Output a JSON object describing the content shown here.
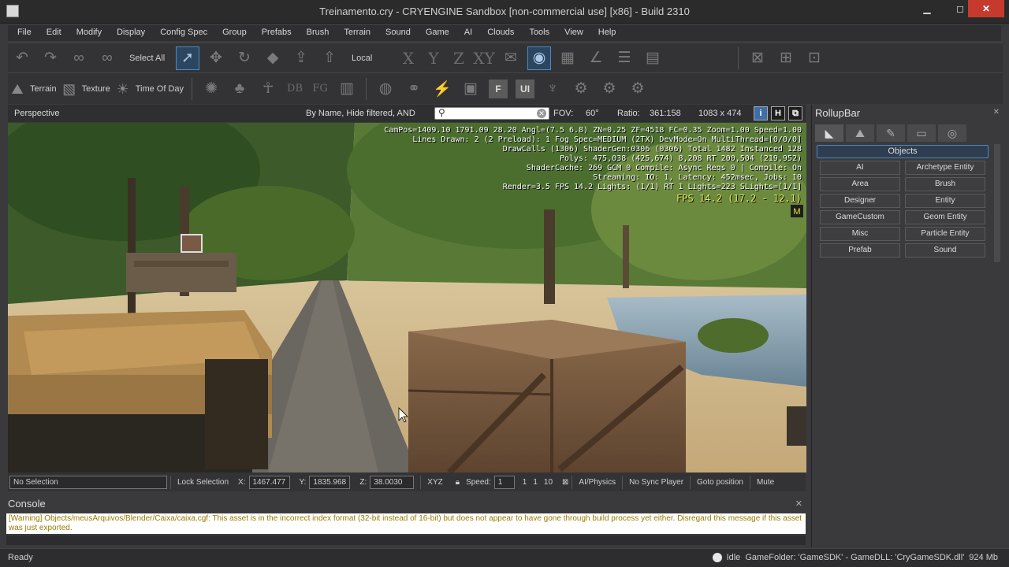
{
  "window": {
    "title": "Treinamento.cry - CRYENGINE Sandbox [non-commercial use] [x86] - Build 2310",
    "minimize": "▁",
    "maximize": "◻",
    "close": "✕"
  },
  "menu": [
    "File",
    "Edit",
    "Modify",
    "Display",
    "Config Spec",
    "Group",
    "Prefabs",
    "Brush",
    "Terrain",
    "Sound",
    "Game",
    "AI",
    "Clouds",
    "Tools",
    "View",
    "Help"
  ],
  "toolbar1": {
    "select_all": "Select All",
    "coord_space": "Local",
    "axis_x": "X",
    "axis_y": "Y",
    "axis_z": "Z",
    "axis_xy": "XY"
  },
  "toolbar2": {
    "terrain": "Terrain",
    "texture": "Texture",
    "time_of_day": "Time Of Day",
    "db": "DB",
    "fg": "FG",
    "f": "F",
    "ui": "UI"
  },
  "viewport_header": {
    "title": "Perspective",
    "filter": "By Name, Hide filtered, AND",
    "fov": "FOV:",
    "fov_value": "60°",
    "ratio": "Ratio:",
    "ratio_value": "361:158",
    "resolution": "1083 x 474",
    "btn_i": "i",
    "btn_h": "H"
  },
  "hud": {
    "lines": [
      "CamPos=1409.10 1791.09 28.20 Angl=(7.5 6.8) ZN=0.25 ZF=4518 FC=0.35 Zoom=1.00 Speed=1.00",
      "Lines Drawn: 2 (2 Preload): 1   Fog Spec=MEDIUM (2TX) DevMode=On MultiThread=[0/0/0]",
      "DrawCalls (1306) ShaderGen:0306 (0306) Total 1482 Instanced 128",
      "Polys: 475,038 (425,674) 8,208 RT 200,504 (219,952)",
      "ShaderCache: 269 GCM 0 Compile: Async Reqs 0 | Compile: On",
      "Streaming: IO: 1, Latency: 452msec, Jobs: 10",
      "Render=3.5 FPS 14.2 Lights: (1/1) RT 1 Lights=223 SLights=[1/1]"
    ],
    "fps": "FPS 14.2 (17.2 - 12.1)"
  },
  "status_row": {
    "selection": "No Selection",
    "lock_selection": "Lock Selection",
    "x_label": "X:",
    "x_value": "1467.477",
    "y_label": "Y:",
    "y_value": "1835.968",
    "z_label": "Z:",
    "z_value": "38.0030",
    "xyz": "XYZ",
    "speed_label": "Speed:",
    "speed_value": "1",
    "speed_opts": [
      "1",
      "1",
      "10"
    ],
    "ai_physics": "AI/Physics",
    "no_sync": "No Sync Player",
    "goto": "Goto position",
    "mute": "Mute"
  },
  "console": {
    "title": "Console",
    "message": "[Warning] Objects/meusArquivos/Blender/Caixa/caixa.cgf: This asset is in the incorrect index format (32-bit instead of 16-bit) but does not appear to have gone through build process yet either. Disregard this message if this asset was just exported."
  },
  "statusbar": {
    "ready": "Ready",
    "idle": "Idle",
    "game_folder": "GameFolder: 'GameSDK' - GameDLL: 'CryGameSDK.dll'",
    "memory": "924 Mb"
  },
  "rollup": {
    "title": "RollupBar",
    "section": "Objects",
    "buttons": [
      "AI",
      "Archetype Entity",
      "Area",
      "Brush",
      "Designer",
      "Entity",
      "GameCustom",
      "Geom Entity",
      "Misc",
      "Particle Entity",
      "Prefab",
      "Sound"
    ]
  }
}
